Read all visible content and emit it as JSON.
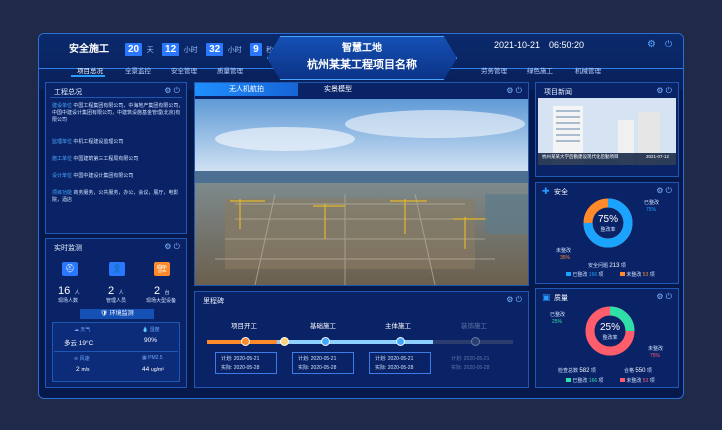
{
  "header": {
    "left_title": "安全施工",
    "counter": [
      {
        "value": "20",
        "unit": "天"
      },
      {
        "value": "12",
        "unit": "小时"
      },
      {
        "value": "32",
        "unit": "小时"
      },
      {
        "value": "9",
        "unit": "秒"
      }
    ],
    "title_line1": "智慧工地",
    "title_line2": "杭州某某工程项目名称",
    "date": "2021-10-21",
    "time": "06:50:20",
    "nav_left": [
      "项目总况",
      "全景监控",
      "安全管理",
      "质量管理"
    ],
    "nav_right": [
      "劳务管理",
      "绿色施工",
      "机械管理"
    ]
  },
  "overview": {
    "title": "工程总况",
    "rows": [
      {
        "label": "建设单位",
        "value": "中国工程集团有限公司，中海地产集团有限公司，中国中建设计集团有限公司，中建筑设施基金管理(北京)有限公司"
      },
      {
        "label": "监理单位",
        "value": "中机工程建设监理公司"
      },
      {
        "label": "施工单位",
        "value": "中国建筑第三工程局有限公司"
      },
      {
        "label": "设计单位",
        "value": "中国中建设计集团有限公司"
      },
      {
        "label": "项目功能",
        "value": "商务服务，公共服务，办公，会议，展厅，电影院，酒店"
      }
    ]
  },
  "monitor": {
    "title": "实时监测",
    "stats": [
      {
        "value": "16",
        "unit": "人",
        "label": "现场人数"
      },
      {
        "value": "2",
        "unit": "人",
        "label": "管理人员"
      },
      {
        "value": "2",
        "unit": "台",
        "label": "现场大型设备"
      }
    ],
    "env_title": "环境监测",
    "env": [
      {
        "label": "天气",
        "value": "多云 19°C"
      },
      {
        "label": "湿度",
        "value": "90%"
      },
      {
        "label": "风速",
        "value": "2",
        "unit": "m/s"
      },
      {
        "label": "PM2.5",
        "value": "44",
        "unit": "ug/m³"
      }
    ]
  },
  "video": {
    "tabs": [
      "无人机航拍",
      "实景模型"
    ]
  },
  "milestones": {
    "title": "里程碑",
    "items": [
      {
        "name": "项目开工",
        "plan": "计划: 2020-05-21",
        "actual": "实际: 2020-05-28"
      },
      {
        "name": "基础施工",
        "plan": "计划: 2020-05-21",
        "actual": "实际: 2020-05-28"
      },
      {
        "name": "主体施工",
        "plan": "计划: 2020-05-21",
        "actual": "实际: 2020-05-28"
      },
      {
        "name": "装饰施工",
        "plan": "计划: 2020-05-21",
        "actual": "实际: 2020-05-28"
      }
    ]
  },
  "news": {
    "title": "项目新闻",
    "caption": "杭州某某大学后勤建设现代化后勤项目",
    "date": "2021-07-12"
  },
  "safety": {
    "title": "安全",
    "percent": "75%",
    "center_label": "整改率",
    "done_label": "已整改",
    "done_pct": "75%",
    "undone_label": "未整改",
    "undone_pct": "35%",
    "total_label": "安全问题",
    "total": "213",
    "total_unit": "项",
    "legend": [
      {
        "label": "已整改",
        "value": "166",
        "unit": "项"
      },
      {
        "label": "未整改",
        "value": "53",
        "unit": "项"
      }
    ],
    "ratio": 0.75
  },
  "quality": {
    "title": "质量",
    "percent": "25%",
    "center_label": "整改率",
    "done_label": "已整改",
    "done_pct": "25%",
    "undone_label": "未整改",
    "undone_pct": "75%",
    "total_label": "检查总数",
    "total": "582",
    "total_unit": "项",
    "pass_label": "合格",
    "pass": "550",
    "pass_unit": "项",
    "legend": [
      {
        "label": "已整改",
        "value": "166",
        "unit": "项"
      },
      {
        "label": "未整改",
        "value": "53",
        "unit": "项"
      }
    ],
    "ratio": 0.25
  },
  "colors": {
    "accent": "#2a78ff",
    "safe": "#1aa3ff",
    "warn": "#ff8a2b",
    "quality": "#ff5d6c"
  }
}
